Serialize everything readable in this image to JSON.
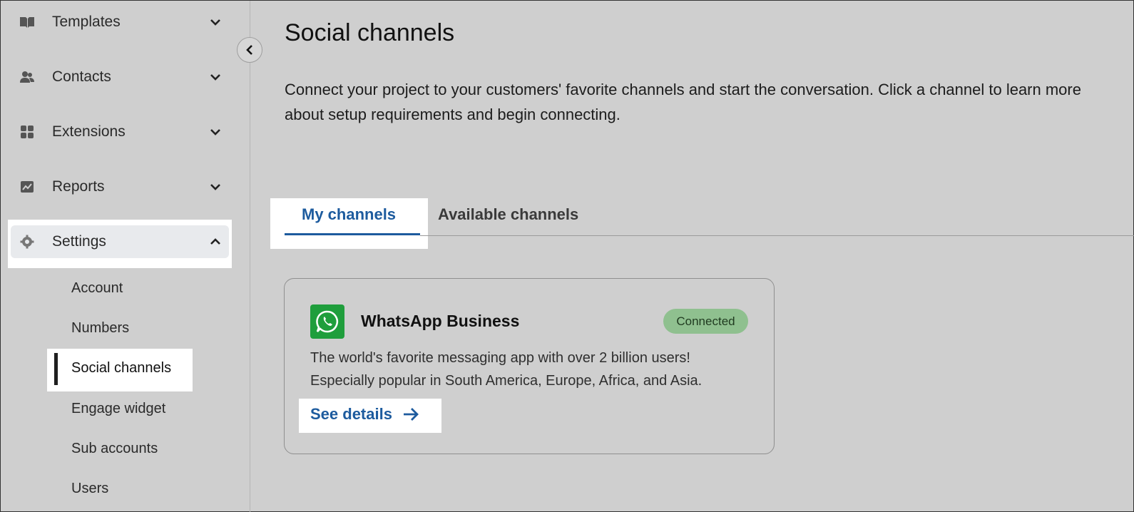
{
  "sidebar": {
    "items": [
      {
        "label": "Templates",
        "icon": "book-icon"
      },
      {
        "label": "Contacts",
        "icon": "contacts-icon"
      },
      {
        "label": "Extensions",
        "icon": "grid-icon"
      },
      {
        "label": "Reports",
        "icon": "chart-icon"
      },
      {
        "label": "Settings",
        "icon": "gear-icon"
      }
    ],
    "settings_sub": [
      "Account",
      "Numbers",
      "Social channels",
      "Engage widget",
      "Sub accounts",
      "Users"
    ]
  },
  "main": {
    "title": "Social channels",
    "description": "Connect your project to your customers' favorite channels and start the conversation. Click a channel to learn more about setup requirements and begin connecting.",
    "tabs": [
      {
        "label": "My channels",
        "active": true
      },
      {
        "label": "Available channels",
        "active": false
      }
    ],
    "card": {
      "title": "WhatsApp Business",
      "status": "Connected",
      "description_line1": "The world's favorite messaging app with over 2 billion users!",
      "description_line2": "Especially popular in South America, Europe, Africa, and Asia.",
      "link": "See details"
    }
  },
  "colors": {
    "accent": "#1d5b9e",
    "whatsapp": "#1f9e3c",
    "badge_bg": "#8fc08f"
  }
}
